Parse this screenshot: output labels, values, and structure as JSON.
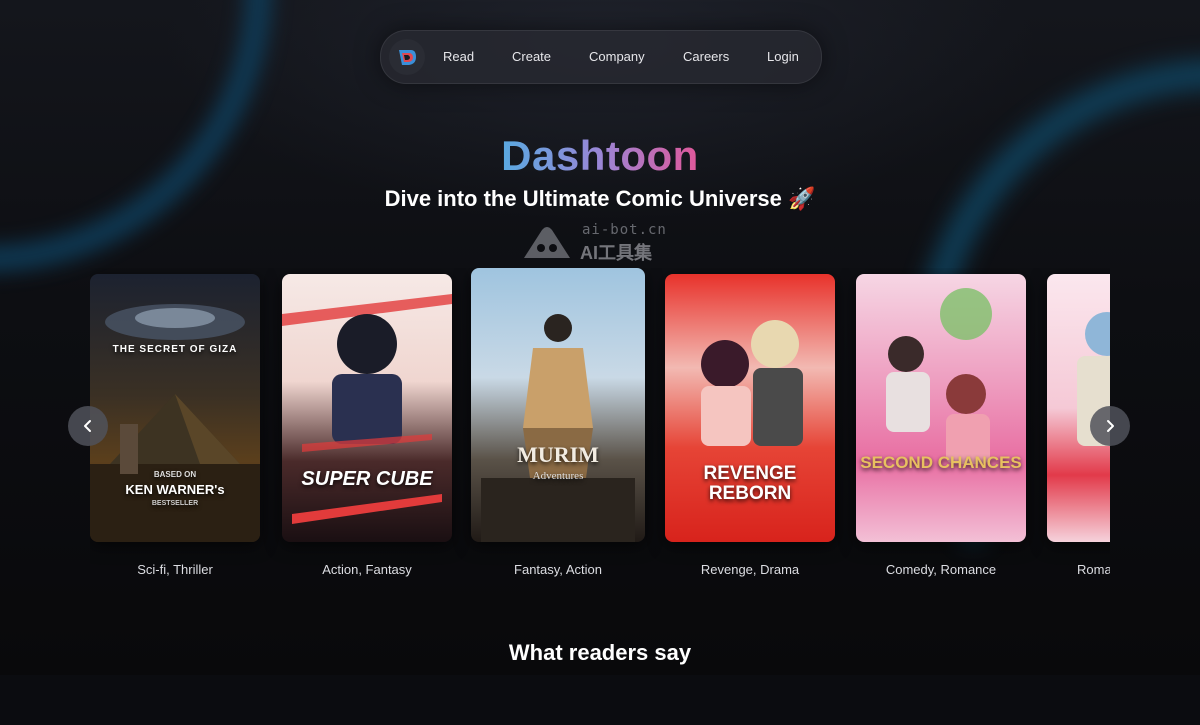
{
  "nav": {
    "links": [
      {
        "label": "Read"
      },
      {
        "label": "Create"
      },
      {
        "label": "Company"
      },
      {
        "label": "Careers"
      },
      {
        "label": "Login"
      }
    ]
  },
  "hero": {
    "brand": "Dashtoon",
    "tagline": "Dive into the Ultimate Comic Universe 🚀"
  },
  "watermark": {
    "line1": "ai-bot.cn",
    "line2": "AI工具集"
  },
  "comics": [
    {
      "cover_text": "THE SECRET OF GIZA",
      "cover_sub": "KEN WARNER's",
      "cover_note": "BESTSELLER",
      "cover_top": "BASED ON",
      "genre": "Sci-fi, Thriller"
    },
    {
      "cover_text": "SUPER CUBE",
      "genre": "Action, Fantasy"
    },
    {
      "cover_text": "MURIM",
      "cover_sub": "Adventures",
      "genre": "Fantasy, Action"
    },
    {
      "cover_text": "REVENGE REBORN",
      "genre": "Revenge, Drama"
    },
    {
      "cover_text": "SECOND CHANCES",
      "genre": "Comedy, Romance"
    },
    {
      "cover_text": "",
      "genre": "Roma"
    }
  ],
  "carousel": {
    "prev_icon": "chevron-left-icon",
    "next_icon": "chevron-right-icon"
  },
  "section": {
    "title": "What readers say"
  },
  "colors": {
    "background": "#0b0c10",
    "brand_gradient_start": "#59a9e0",
    "brand_gradient_end": "#e0589a",
    "nav_bg": "#282a32"
  }
}
